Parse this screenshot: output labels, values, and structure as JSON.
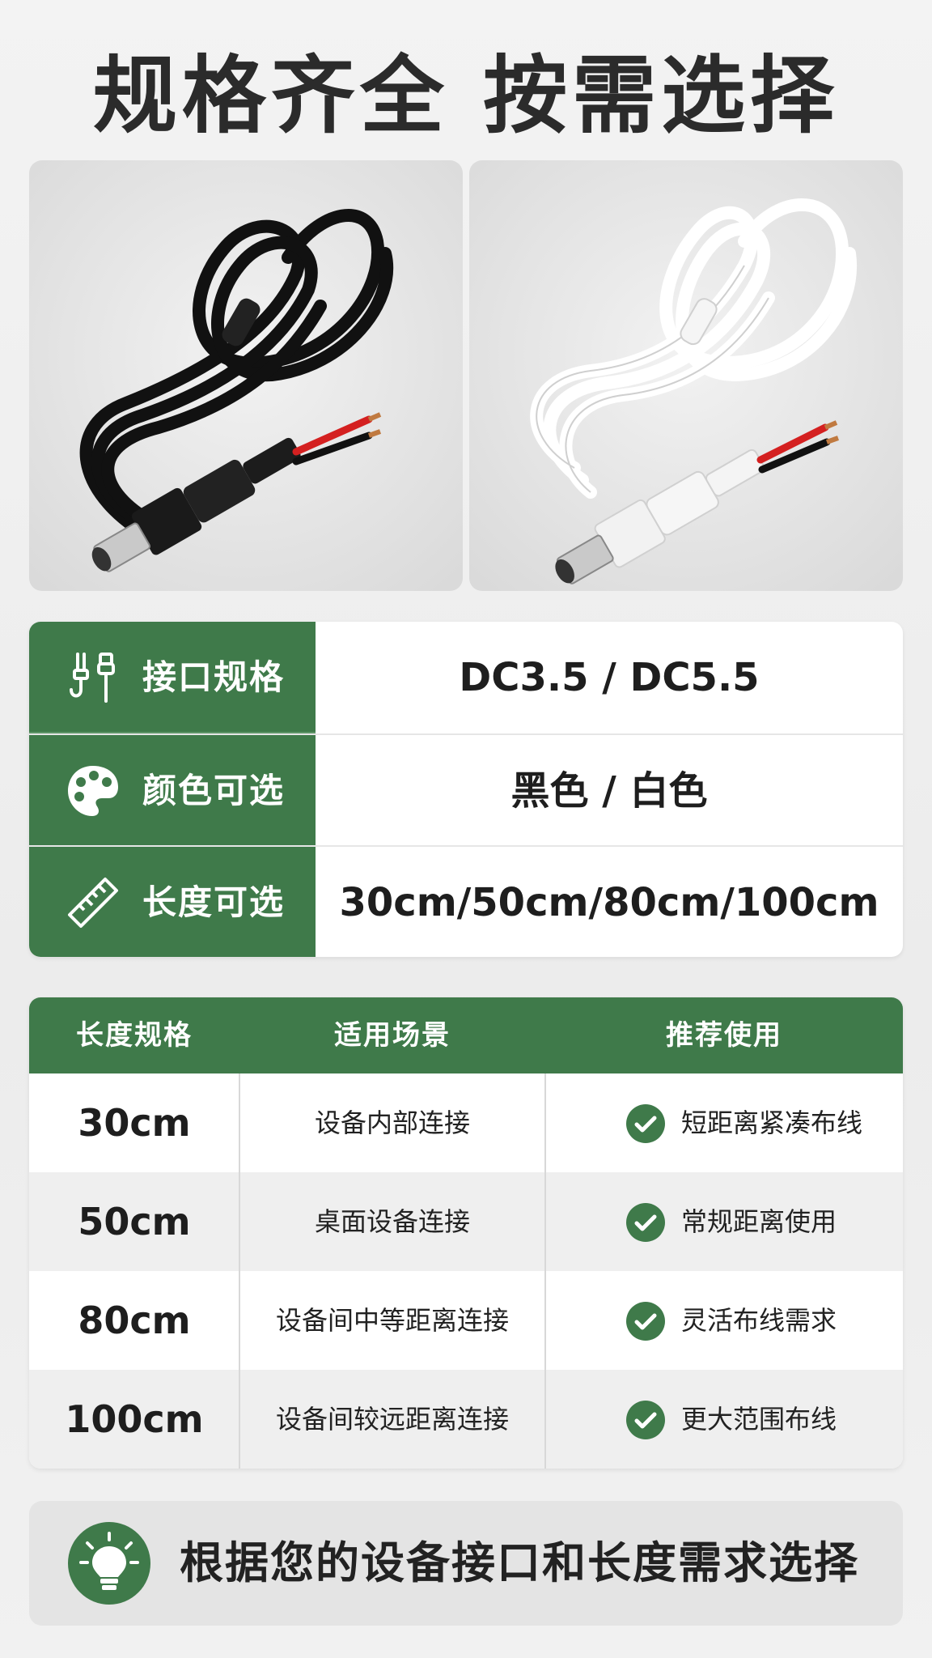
{
  "title": "规格齐全 按需选择",
  "photos": {
    "left": {
      "icon": "black-dc-cable-icon"
    },
    "right": {
      "icon": "white-dc-cable-icon"
    }
  },
  "spec": {
    "rows": [
      {
        "icon": "connector-plug-icon",
        "label": "接口规格",
        "value": "DC3.5 / DC5.5"
      },
      {
        "icon": "palette-icon",
        "label": "颜色可选",
        "value": "黑色 / 白色"
      },
      {
        "icon": "ruler-icon",
        "label": "长度可选",
        "value": "30cm/50cm/80cm/100cm"
      }
    ]
  },
  "usage": {
    "headers": [
      "长度规格",
      "适用场景",
      "推荐使用"
    ],
    "rows": [
      {
        "length": "30cm",
        "scene": "设备内部连接",
        "recommend": "短距离紧凑布线"
      },
      {
        "length": "50cm",
        "scene": "桌面设备连接",
        "recommend": "常规距离使用"
      },
      {
        "length": "80cm",
        "scene": "设备间中等距离连接",
        "recommend": "灵活布线需求"
      },
      {
        "length": "100cm",
        "scene": "设备间较远距离连接",
        "recommend": "更大范围布线"
      }
    ]
  },
  "footer": {
    "icon": "lightbulb-icon",
    "text": "根据您的设备接口和长度需求选择"
  },
  "colors": {
    "accent": "#3f7a4a",
    "background": "#f0f0f0"
  }
}
